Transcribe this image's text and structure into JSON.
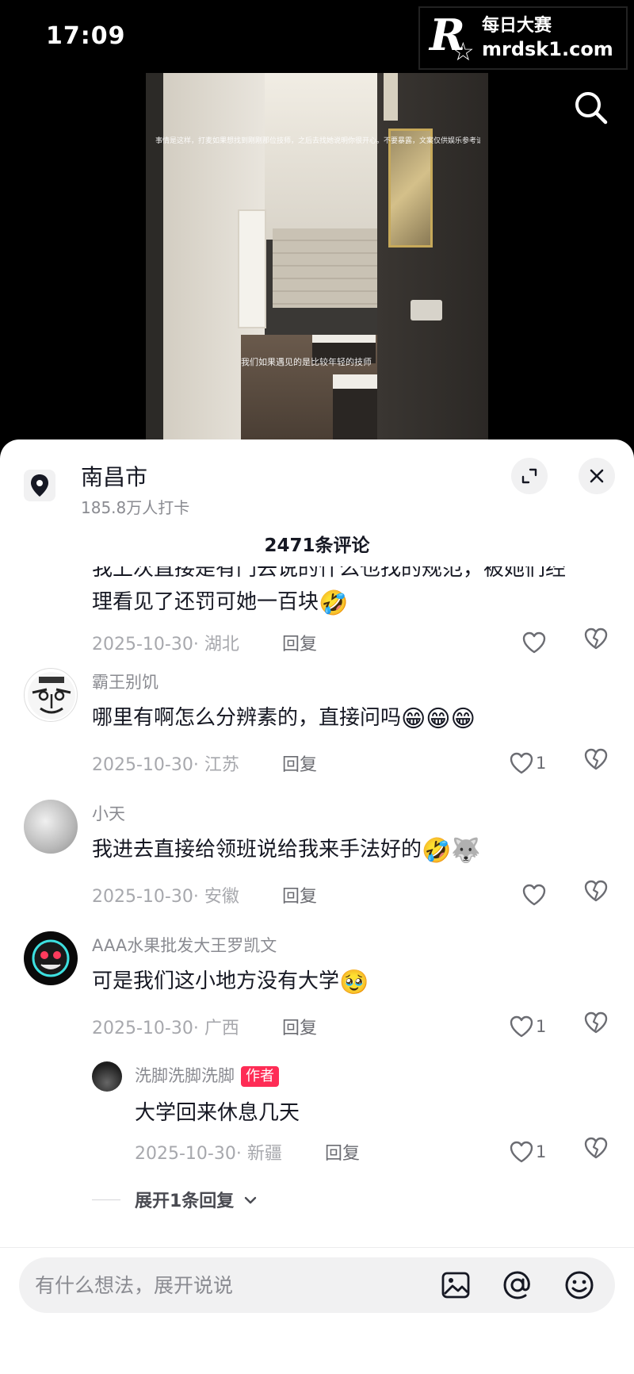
{
  "status": {
    "time": "17:09"
  },
  "watermark": {
    "logo_letter": "R",
    "line1": "每日大赛",
    "line2": "mrdsk1.com"
  },
  "video": {
    "caption_top": "事情是这样，打麦如果想找到刚刚那位技师，之后去找她说明你很开心。不要暴露，文案仅供娱乐参考请勿当真",
    "caption_mid": "我们如果遇见的是比较年轻的技师"
  },
  "location": {
    "name": "南昌市",
    "checkins": "185.8万人打卡"
  },
  "comments_header": {
    "title": "2471条评论"
  },
  "comments": [
    {
      "text_line1": "我上次直接是有门去说的什么也找的规范，被她们经",
      "text_line2": "理看见了还罚可她一百块",
      "emoji": "🤣",
      "date_location": "2025-10-30· 湖北",
      "reply_label": "回复",
      "likes": ""
    },
    {
      "username": "霸王别饥",
      "text": "哪里有啊怎么分辨素的，直接问吗",
      "emoji": "😁😁😁",
      "date_location": "2025-10-30· 江苏",
      "reply_label": "回复",
      "likes": "1"
    },
    {
      "username": "小天",
      "text": "我进去直接给领班说给我来手法好的",
      "emoji": "🤣🐺",
      "date_location": "2025-10-30· 安徽",
      "reply_label": "回复",
      "likes": ""
    },
    {
      "username": "AAA水果批发大王罗凯文",
      "text": "可是我们这小地方没有大学",
      "emoji": "🥹",
      "date_location": "2025-10-30· 广西",
      "reply_label": "回复",
      "likes": "1"
    }
  ],
  "reply": {
    "username": "洗脚洗脚洗脚",
    "badge": "作者",
    "text": "大学回来休息几天",
    "date_location": "2025-10-30· 新疆",
    "reply_label": "回复",
    "likes": "1"
  },
  "expand_replies": {
    "label": "展开1条回复"
  },
  "input": {
    "placeholder": "有什么想法，展开说说"
  }
}
